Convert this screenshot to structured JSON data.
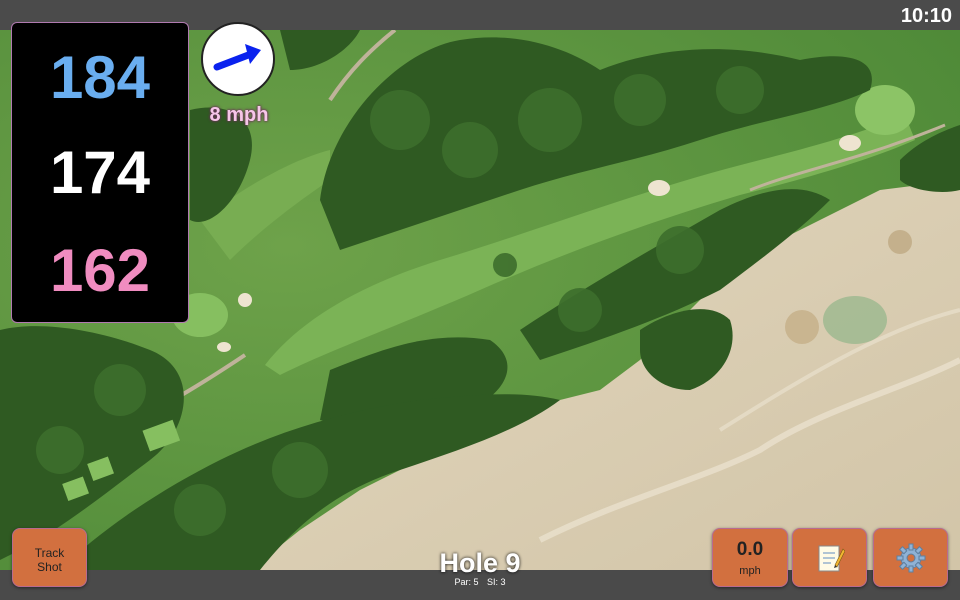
{
  "status_bar": {
    "clock": "10:10"
  },
  "distances": {
    "back": "184",
    "middle": "174",
    "front": "162"
  },
  "wind": {
    "speed": "8 mph",
    "arrow_icon": "arrow-right-icon"
  },
  "buttons": {
    "track_shot": {
      "line1": "Track",
      "line2": "Shot"
    },
    "speed": {
      "value": "0.0",
      "unit": "mph"
    },
    "notes": {
      "icon": "notepad-icon"
    },
    "settings": {
      "icon": "gear-icon"
    }
  },
  "hole": {
    "title": "Hole 9",
    "par": "Par: 5",
    "si": "SI: 3"
  },
  "colors": {
    "back": "#6aaef0",
    "middle": "#ffffff",
    "front": "#f08cc0",
    "button": "#d2703f"
  }
}
